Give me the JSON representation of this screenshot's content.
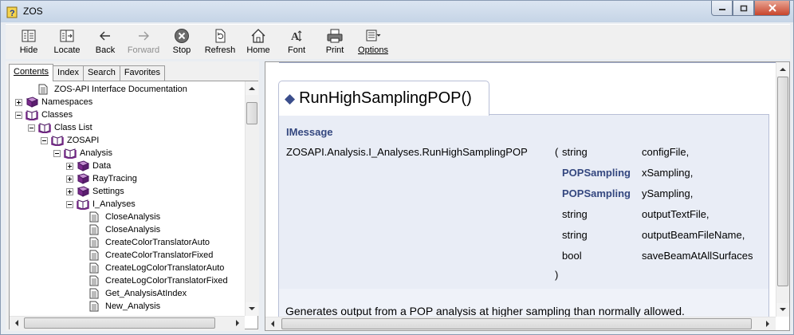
{
  "window": {
    "title": "ZOS",
    "controls": [
      "minimize-icon",
      "maximize-icon",
      "close-icon"
    ]
  },
  "toolbar": {
    "items": [
      {
        "label": "Hide",
        "icon": "hide-icon",
        "enabled": true
      },
      {
        "label": "Locate",
        "icon": "locate-icon",
        "enabled": true
      },
      {
        "label": "Back",
        "icon": "back-arrow-icon",
        "enabled": true
      },
      {
        "label": "Forward",
        "icon": "forward-arrow-icon",
        "enabled": false
      },
      {
        "label": "Stop",
        "icon": "stop-icon",
        "enabled": true
      },
      {
        "label": "Refresh",
        "icon": "refresh-icon",
        "enabled": true
      },
      {
        "label": "Home",
        "icon": "home-icon",
        "enabled": true
      },
      {
        "label": "Font",
        "icon": "font-icon",
        "enabled": true
      },
      {
        "label": "Print",
        "icon": "print-icon",
        "enabled": true
      },
      {
        "label": "Options",
        "icon": "options-icon",
        "enabled": true
      }
    ]
  },
  "nav": {
    "tabs": [
      "Contents",
      "Index",
      "Search",
      "Favorites"
    ],
    "active_tab": "Contents",
    "tree": [
      {
        "label": "ZOS-API Interface Documentation",
        "icon": "page-icon",
        "expander": "none",
        "level": 1
      },
      {
        "label": "Namespaces",
        "icon": "book-closed-icon",
        "expander": "plus",
        "level": 0
      },
      {
        "label": "Classes",
        "icon": "book-open-icon",
        "expander": "minus",
        "level": 0
      },
      {
        "label": "Class List",
        "icon": "book-open-icon",
        "expander": "minus",
        "level": 1
      },
      {
        "label": "ZOSAPI",
        "icon": "book-open-icon",
        "expander": "minus",
        "level": 2
      },
      {
        "label": "Analysis",
        "icon": "book-open-icon",
        "expander": "minus",
        "level": 3
      },
      {
        "label": "Data",
        "icon": "book-closed-icon",
        "expander": "plus",
        "level": 4
      },
      {
        "label": "RayTracing",
        "icon": "book-closed-icon",
        "expander": "plus",
        "level": 4
      },
      {
        "label": "Settings",
        "icon": "book-closed-icon",
        "expander": "plus",
        "level": 4
      },
      {
        "label": "I_Analyses",
        "icon": "book-open-icon",
        "expander": "minus",
        "level": 4
      },
      {
        "label": "CloseAnalysis",
        "icon": "page-icon",
        "expander": "none",
        "level": 5
      },
      {
        "label": "CloseAnalysis",
        "icon": "page-icon",
        "expander": "none",
        "level": 5
      },
      {
        "label": "CreateColorTranslatorAuto",
        "icon": "page-icon",
        "expander": "none",
        "level": 5
      },
      {
        "label": "CreateColorTranslatorFixed",
        "icon": "page-icon",
        "expander": "none",
        "level": 5
      },
      {
        "label": "CreateLogColorTranslatorAuto",
        "icon": "page-icon",
        "expander": "none",
        "level": 5
      },
      {
        "label": "CreateLogColorTranslatorFixed",
        "icon": "page-icon",
        "expander": "none",
        "level": 5
      },
      {
        "label": "Get_AnalysisAtIndex",
        "icon": "page-icon",
        "expander": "none",
        "level": 5
      },
      {
        "label": "New_Analysis",
        "icon": "page-icon",
        "expander": "none",
        "level": 5
      }
    ]
  },
  "content": {
    "member_title": "RunHighSamplingPOP()",
    "language": "IMessage",
    "method": "ZOSAPI.Analysis.I_Analyses.RunHighSamplingPOP",
    "open_paren": "(",
    "close_paren": ")",
    "params": [
      {
        "type": "string",
        "name": "configFile,",
        "type_is_link": false
      },
      {
        "type": "POPSampling",
        "name": "xSampling,",
        "type_is_link": true
      },
      {
        "type": "POPSampling",
        "name": "ySampling,",
        "type_is_link": true
      },
      {
        "type": "string",
        "name": "outputTextFile,",
        "type_is_link": false
      },
      {
        "type": "string",
        "name": "outputBeamFileName,",
        "type_is_link": false
      },
      {
        "type": "bool",
        "name": "saveBeamAtAllSurfaces",
        "type_is_link": false
      }
    ],
    "description": "Generates output from a POP analysis at higher sampling than normally allowed."
  },
  "colors": {
    "link": "#34477f",
    "book": "#7b2a8c",
    "syntax_bg": "#e9edf6"
  }
}
